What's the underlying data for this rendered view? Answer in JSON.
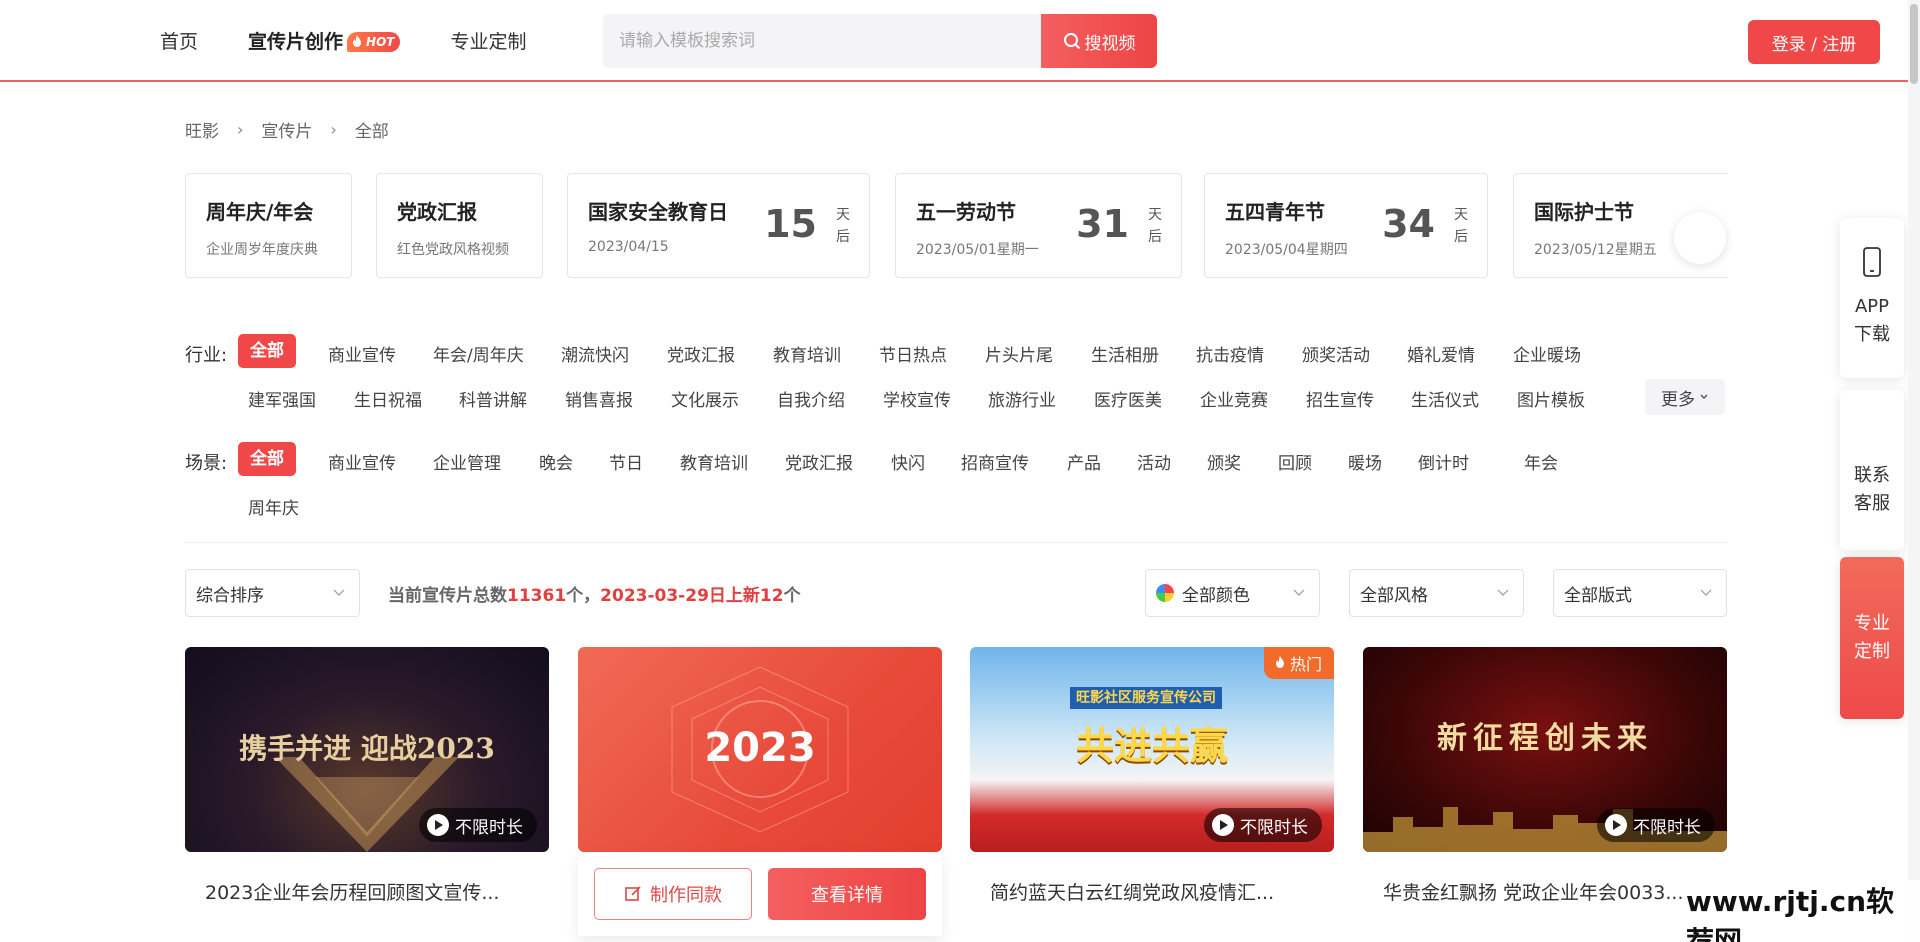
{
  "nav": {
    "home": "首页",
    "create": "宣传片创作",
    "hot": "HOT",
    "custom": "专业定制"
  },
  "search": {
    "placeholder": "请输入模板搜索词",
    "button": "搜视频"
  },
  "login": "登录 / 注册",
  "breadcrumb": [
    "旺影",
    "宣传片",
    "全部"
  ],
  "holidays": [
    {
      "title": "周年庆/年会",
      "sub": "企业周岁年度庆典"
    },
    {
      "title": "党政汇报",
      "sub": "红色党政风格视频"
    },
    {
      "title": "国家安全教育日",
      "sub": "2023/04/15",
      "days": "15",
      "unit": "天后"
    },
    {
      "title": "五一劳动节",
      "sub": "2023/05/01星期一",
      "days": "31",
      "unit": "天后"
    },
    {
      "title": "五四青年节",
      "sub": "2023/05/04星期四",
      "days": "34",
      "unit": "天后"
    },
    {
      "title": "国际护士节",
      "sub": "2023/05/12星期五"
    }
  ],
  "industry": {
    "label": "行业:",
    "row1": [
      "全部",
      "商业宣传",
      "年会/周年庆",
      "潮流快闪",
      "党政汇报",
      "教育培训",
      "节日热点",
      "片头片尾",
      "生活相册",
      "抗击疫情",
      "颁奖活动",
      "婚礼爱情",
      "企业暖场"
    ],
    "row2": [
      "建军强国",
      "生日祝福",
      "科普讲解",
      "销售喜报",
      "文化展示",
      "自我介绍",
      "学校宣传",
      "旅游行业",
      "医疗医美",
      "企业竞赛",
      "招生宣传",
      "生活仪式",
      "图片模板"
    ],
    "more": "更多"
  },
  "scene": {
    "label": "场景:",
    "row1": [
      "全部",
      "商业宣传",
      "企业管理",
      "晚会",
      "节日",
      "教育培训",
      "党政汇报",
      "快闪",
      "招商宣传",
      "产品",
      "活动",
      "颁奖",
      "回顾",
      "暖场",
      "倒计时",
      "年会"
    ],
    "row2": [
      "周年庆"
    ]
  },
  "sort": {
    "order": "综合排序",
    "color": "全部颜色",
    "style": "全部风格",
    "format": "全部版式"
  },
  "stats": {
    "prefix": "当前宣传片总数",
    "total": "11361",
    "mid": "个，",
    "date": "2023-03-29",
    "mid2": "日上新",
    "new": "12",
    "suffix": "个"
  },
  "videos": [
    {
      "thumb_text": "携手并进 迎战2023",
      "duration": "不限时长",
      "title": "2023企业年会历程回顾图文宣传..."
    },
    {
      "thumb_text": "2023",
      "make": "制作同款",
      "detail": "查看详情"
    },
    {
      "thumb_text": "共进共赢",
      "banner": "旺影社区服务宣传公司",
      "hot": "热门",
      "duration": "不限时长",
      "title": "简约蓝天白云红绸党政风疫情汇..."
    },
    {
      "thumb_text": "新征程创未来",
      "duration": "不限时长",
      "title": "华贵金红飘扬 党政企业年会0033..."
    }
  ],
  "side": {
    "app": "APP下载",
    "service": "联系客服",
    "custom": "专业定制"
  },
  "watermark": "www.rjtj.cn软荐网",
  "colors": {
    "accent": "#f04848",
    "hot": "#f26b2a"
  }
}
